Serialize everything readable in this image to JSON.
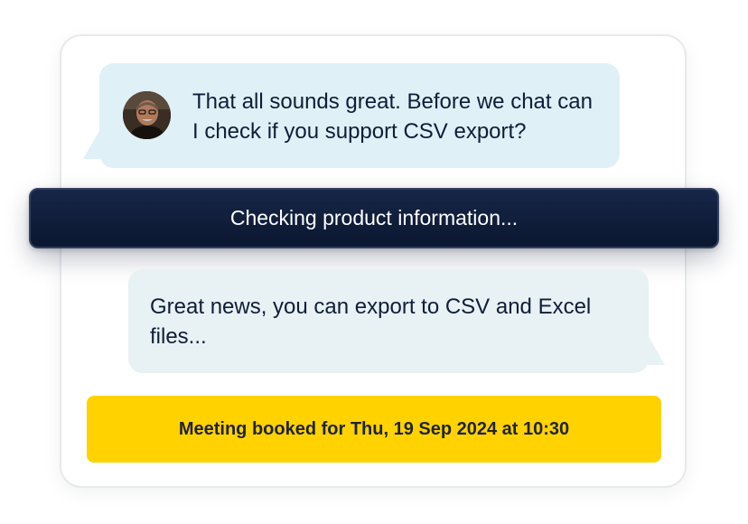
{
  "conversation": {
    "user_message": {
      "text": "That all sounds great. Before we chat can I check if you support CSV export?",
      "avatar_icon": "person-photo-avatar"
    },
    "status": {
      "text": "Checking product information..."
    },
    "assistant_message": {
      "text": "Great news, you can export to CSV and Excel files..."
    },
    "booking_banner": {
      "text": "Meeting booked for Thu, 19 Sep 2024 at 10:30"
    }
  },
  "colors": {
    "user_bubble": "#dff0f6",
    "assistant_bubble": "#e8f1f3",
    "status_bar": "#0f1d3a",
    "banner": "#ffd200",
    "text": "#0f1d3a"
  }
}
